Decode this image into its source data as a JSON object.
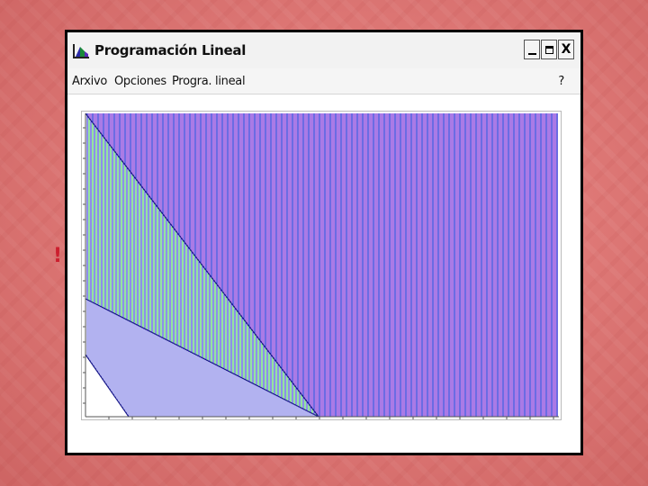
{
  "window": {
    "title": "Programación Lineal",
    "close_glyph": "X"
  },
  "menu": {
    "items": [
      "Arxivo",
      "Opciones",
      "Progra. lineal"
    ],
    "help": "?"
  },
  "background": {
    "stray_mark": "!"
  },
  "colors": {
    "slide_background": "#e07a78",
    "region_purple": "#7c34d8",
    "region_blue": "#1c1cd4",
    "region_green": "#28c840",
    "constraint_line": "#1a1a8a"
  }
}
